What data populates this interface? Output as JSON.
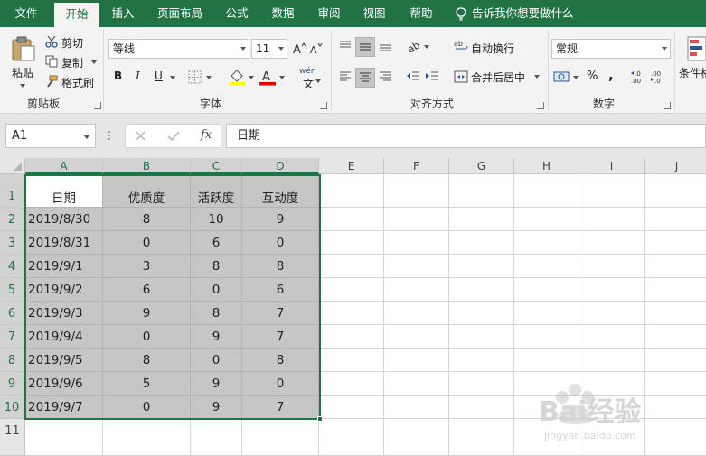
{
  "ribbon_tabs": [
    "文件",
    "开始",
    "插入",
    "页面布局",
    "公式",
    "数据",
    "审阅",
    "视图",
    "帮助"
  ],
  "tell_me": "告诉我你想要做什么",
  "clipboard": {
    "paste": "粘贴",
    "cut": "剪切",
    "copy": "复制",
    "format_painter": "格式刷",
    "group": "剪贴板"
  },
  "font": {
    "name": "等线",
    "size": "11",
    "group": "字体",
    "bold": "B",
    "italic": "I",
    "underline": "U",
    "wen": "wén",
    "wen2": "文"
  },
  "alignment": {
    "wrap": "自动换行",
    "merge": "合并后居中",
    "group": "对齐方式"
  },
  "number": {
    "format": "常规",
    "group": "数字",
    "percent": "%",
    "comma": ","
  },
  "styles": {
    "conditional": "条件格"
  },
  "formula_bar": {
    "cell_ref": "A1",
    "fx": "fx",
    "content": "日期"
  },
  "columns": [
    "A",
    "B",
    "C",
    "D",
    "E",
    "F",
    "G",
    "H",
    "I",
    "J"
  ],
  "rows": [
    "1",
    "2",
    "3",
    "4",
    "5",
    "6",
    "7",
    "8",
    "9",
    "10",
    "11"
  ],
  "table": {
    "headers": [
      "日期",
      "优质度",
      "活跃度",
      "互动度"
    ],
    "rows": [
      [
        "2019/8/30",
        "8",
        "10",
        "9"
      ],
      [
        "2019/8/31",
        "0",
        "6",
        "0"
      ],
      [
        "2019/9/1",
        "3",
        "8",
        "8"
      ],
      [
        "2019/9/2",
        "6",
        "0",
        "6"
      ],
      [
        "2019/9/3",
        "9",
        "8",
        "7"
      ],
      [
        "2019/9/4",
        "0",
        "9",
        "7"
      ],
      [
        "2019/9/5",
        "8",
        "0",
        "8"
      ],
      [
        "2019/9/6",
        "5",
        "9",
        "0"
      ],
      [
        "2019/9/7",
        "0",
        "9",
        "7"
      ]
    ]
  },
  "watermark": {
    "brand": "Bai经验",
    "url": "jingyan.baidu.com"
  },
  "colors": {
    "accent": "#217346",
    "selection_fill": "#c6c6c6"
  }
}
